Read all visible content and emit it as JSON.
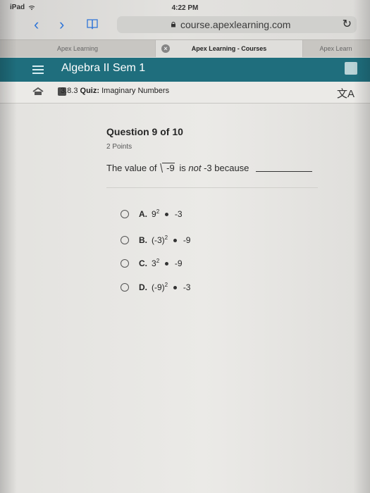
{
  "status": {
    "device": "iPad",
    "time": "4:22 PM"
  },
  "browser": {
    "url": "course.apexlearning.com"
  },
  "tabs": [
    {
      "label": "Apex Learning"
    },
    {
      "label": "Apex Learning - Courses"
    },
    {
      "label": "Apex Learn"
    }
  ],
  "course": {
    "title": "Algebra II Sem 1"
  },
  "breadcrumb": {
    "section": "3.8.3",
    "quiz_label": "Quiz:",
    "quiz_title": "Imaginary Numbers"
  },
  "question": {
    "title": "Question 9 of 10",
    "points": "2 Points",
    "prompt_prefix": "The value of",
    "radicand": "-9",
    "prompt_middle": "is",
    "emphasis": "not",
    "prompt_suffix": "-3 because"
  },
  "options": [
    {
      "letter": "A.",
      "base": "9",
      "exp": "2",
      "rhs": "-3"
    },
    {
      "letter": "B.",
      "base": "(-3)",
      "exp": "2",
      "rhs": "-9"
    },
    {
      "letter": "C.",
      "base": "3",
      "exp": "2",
      "rhs": "-9"
    },
    {
      "letter": "D.",
      "base": "(-9)",
      "exp": "2",
      "rhs": "-3"
    }
  ]
}
